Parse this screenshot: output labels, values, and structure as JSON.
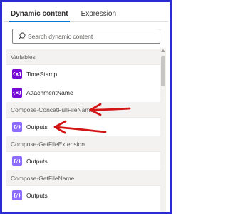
{
  "tabs": [
    {
      "label": "Dynamic content",
      "active": true
    },
    {
      "label": "Expression",
      "active": false
    }
  ],
  "search": {
    "placeholder": "Search dynamic content"
  },
  "sections": [
    {
      "header": "Variables",
      "items": [
        {
          "label": "TimeStamp",
          "icon": "variable-icon",
          "icon_text": "{x}",
          "color": "#770bd6"
        },
        {
          "label": "AttachmentName",
          "icon": "variable-icon",
          "icon_text": "{x}",
          "color": "#770bd6"
        }
      ]
    },
    {
      "header": "Compose-ConcatFullFileName",
      "items": [
        {
          "label": "Outputs",
          "icon": "compose-icon",
          "icon_text": "{/}",
          "color": "#8c6cff"
        }
      ]
    },
    {
      "header": "Compose-GetFileExtension",
      "items": [
        {
          "label": "Outputs",
          "icon": "compose-icon",
          "icon_text": "{/}",
          "color": "#8c6cff"
        }
      ]
    },
    {
      "header": "Compose-GetFileName",
      "items": [
        {
          "label": "Outputs",
          "icon": "compose-icon",
          "icon_text": "{/}",
          "color": "#8c6cff"
        }
      ]
    }
  ],
  "colors": {
    "frame": "#2b2bd6",
    "accent": "#0078d4",
    "annotation": "#d41515"
  }
}
